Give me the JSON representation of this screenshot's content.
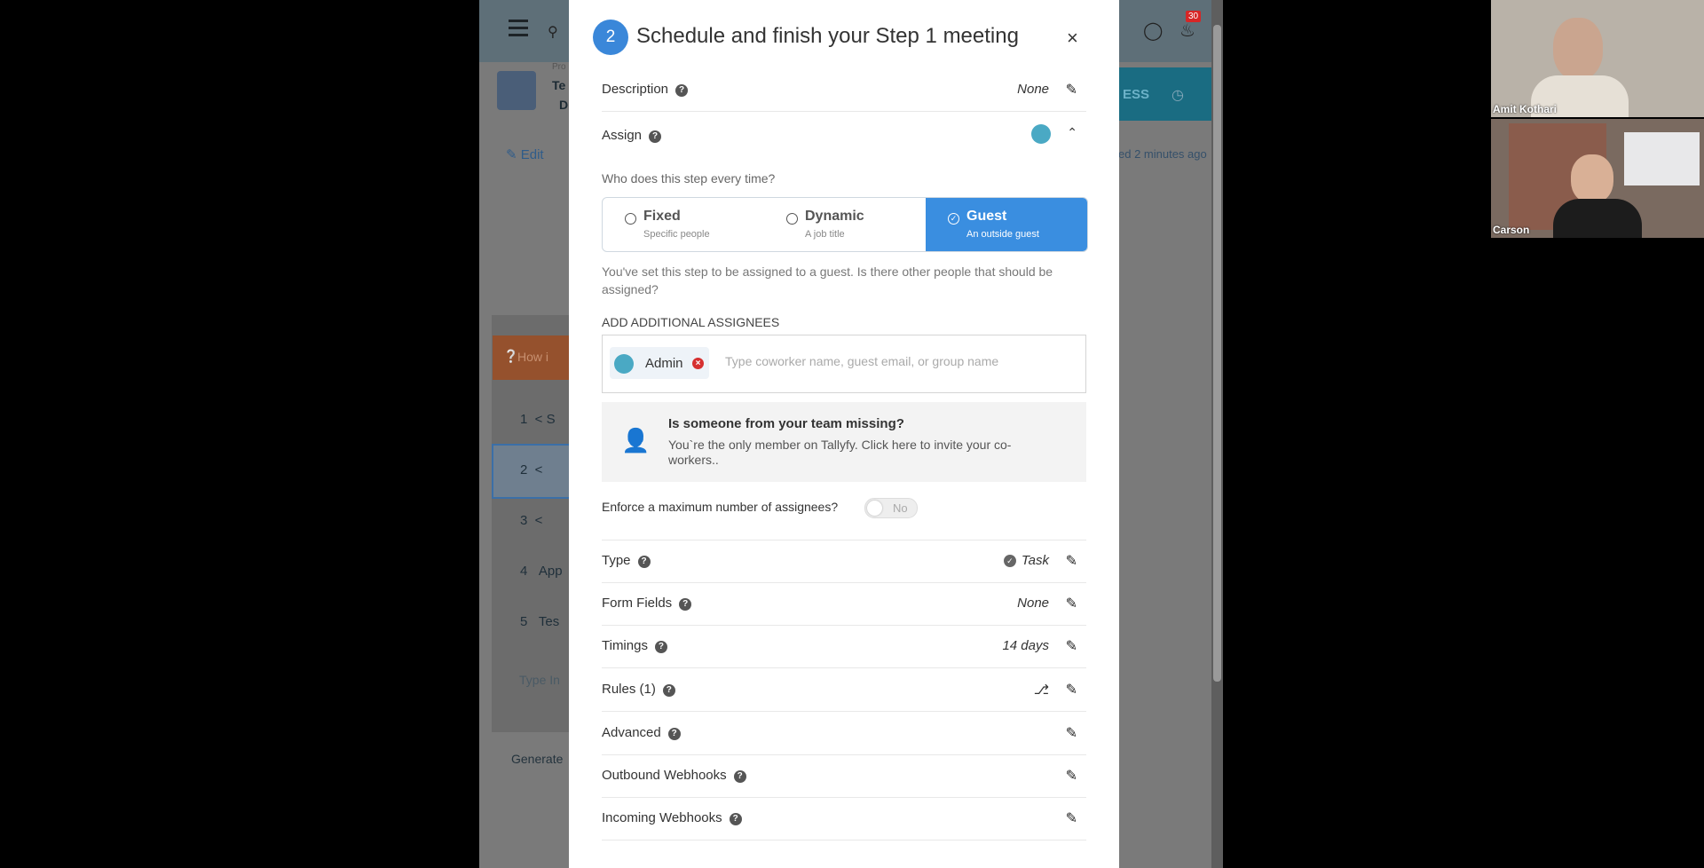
{
  "background_app": {
    "bell_count": "30",
    "template_line1": "Te",
    "template_line2": "D",
    "process_label": "Pro",
    "edit_label": "Edit",
    "right_button": "ESS",
    "saved_text": "ed 2 minutes ago",
    "how_label": "How i",
    "steps": [
      {
        "num": "1",
        "label": "S"
      },
      {
        "num": "2",
        "label": ""
      },
      {
        "num": "3",
        "label": ""
      },
      {
        "num": "4",
        "label": "App"
      },
      {
        "num": "5",
        "label": "Tes"
      }
    ],
    "type_in_placeholder": "Type In",
    "generate_label": "Generate"
  },
  "modal": {
    "step_number": "2",
    "title": "Schedule and finish your Step 1 meeting",
    "close": "×",
    "description": {
      "label": "Description",
      "value": "None"
    },
    "assign": {
      "label": "Assign"
    },
    "question": "Who does this step every time?",
    "assign_options": [
      {
        "title": "Fixed",
        "subtitle": "Specific people",
        "selected": false
      },
      {
        "title": "Dynamic",
        "subtitle": "A job title",
        "selected": false
      },
      {
        "title": "Guest",
        "subtitle": "An outside guest",
        "selected": true
      }
    ],
    "guest_info": "You've set this step to be assigned to a guest. Is there other people that should be assigned?",
    "additional_header": "ADD ADDITIONAL ASSIGNEES",
    "assignee_chip": "Admin",
    "assignee_placeholder": "Type coworker name, guest email, or group name",
    "missing": {
      "title": "Is someone from your team missing?",
      "subtitle": "You`re the only member on Tallyfy. Click here to invite your co-workers.."
    },
    "enforce_label": "Enforce a maximum number of assignees?",
    "enforce_toggle": "No",
    "type": {
      "label": "Type",
      "value": "Task"
    },
    "form_fields": {
      "label": "Form Fields",
      "value": "None"
    },
    "timings": {
      "label": "Timings",
      "value": "14 days"
    },
    "rules": {
      "label": "Rules (1)"
    },
    "advanced": {
      "label": "Advanced"
    },
    "outbound": {
      "label": "Outbound Webhooks"
    },
    "incoming": {
      "label": "Incoming Webhooks"
    }
  },
  "video": {
    "participant1": "Amit Kothari",
    "participant2": "Carson"
  },
  "colors": {
    "accent": "#3a8ee0",
    "danger": "#d63030"
  }
}
